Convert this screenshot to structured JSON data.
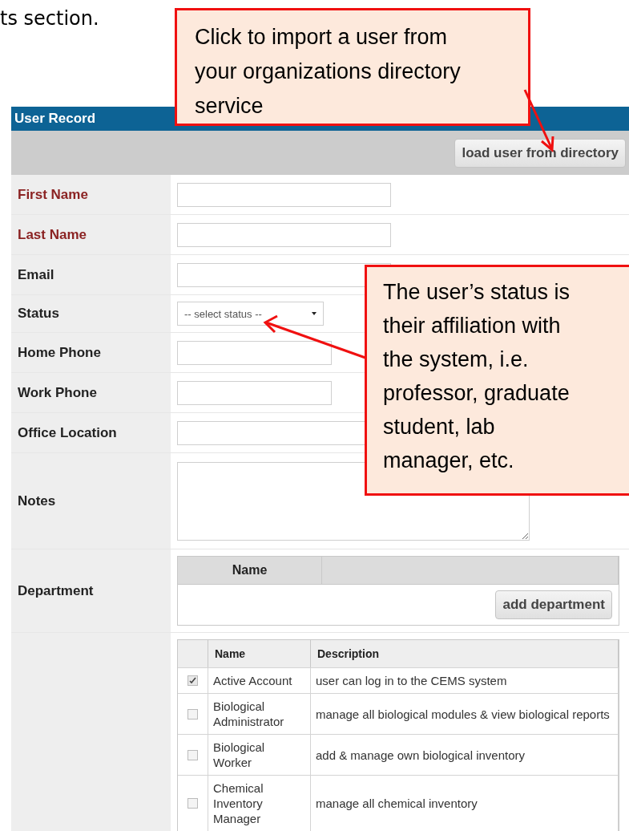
{
  "page_text": "ts section.",
  "form": {
    "title": "User Record",
    "load_button": "load user from directory",
    "fields": [
      {
        "label": "First Name",
        "kind": "input",
        "required": true
      },
      {
        "label": "Last Name",
        "kind": "input",
        "required": true
      },
      {
        "label": "Email",
        "kind": "input",
        "required": false
      },
      {
        "label": "Status",
        "kind": "select",
        "required": false,
        "placeholder": "-- select status --"
      },
      {
        "label": "Home Phone",
        "kind": "short_input",
        "required": false
      },
      {
        "label": "Work Phone",
        "kind": "short_input",
        "required": false
      },
      {
        "label": "Office Location",
        "kind": "input",
        "required": false
      },
      {
        "label": "Notes",
        "kind": "textarea",
        "required": false
      }
    ],
    "department": {
      "label": "Department",
      "columns": [
        "Name"
      ],
      "add_button": "add department"
    },
    "roles": {
      "columns": [
        "Name",
        "Description"
      ],
      "rows": [
        {
          "name": "Active Account",
          "description": "user can log in to the CEMS system",
          "checked": true
        },
        {
          "name": "Biological Administrator",
          "description": "manage all biological modules & view biological reports",
          "checked": false
        },
        {
          "name": "Biological Worker",
          "description": "add & manage own biological inventory",
          "checked": false
        },
        {
          "name": "Chemical Inventory Manager",
          "description": "manage all chemical inventory",
          "checked": false
        }
      ]
    }
  },
  "callouts": [
    {
      "text": "Click to import a user from your organizations directory service"
    },
    {
      "text": "The user’s status is their affiliation with the system, i.e. professor, graduate student, lab manager, etc."
    }
  ]
}
